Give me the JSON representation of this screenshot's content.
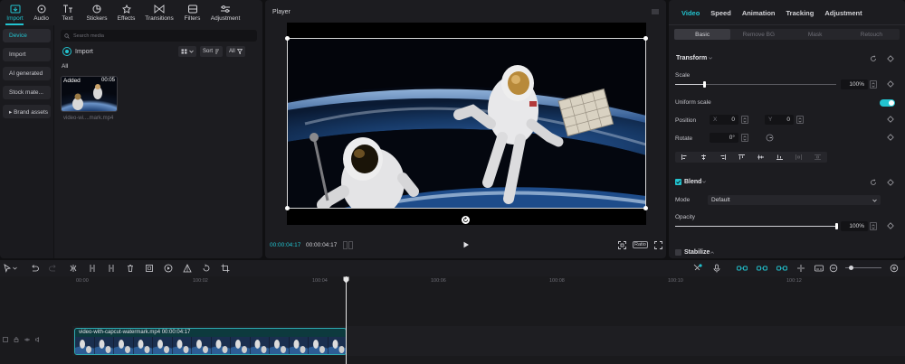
{
  "top_tools": [
    {
      "label": "Import",
      "icon": "import-icon"
    },
    {
      "label": "Audio",
      "icon": "audio-icon"
    },
    {
      "label": "Text",
      "icon": "text-icon"
    },
    {
      "label": "Stickers",
      "icon": "stickers-icon"
    },
    {
      "label": "Effects",
      "icon": "effects-icon"
    },
    {
      "label": "Transitions",
      "icon": "transitions-icon"
    },
    {
      "label": "Filters",
      "icon": "filters-icon"
    },
    {
      "label": "Adjustment",
      "icon": "adjustment-icon"
    }
  ],
  "left_nav": [
    {
      "label": "Device"
    },
    {
      "label": "Import"
    },
    {
      "label": "AI generated"
    },
    {
      "label": "Stock mate..."
    },
    {
      "label": "▸ Brand assets"
    }
  ],
  "media": {
    "search_placeholder": "Search media",
    "import_label": "Import",
    "sort_label": "Sort",
    "all_button": "All",
    "all_section": "All",
    "thumb": {
      "badge": "Added",
      "duration": "00:05",
      "filename": "video-wi....mark.mp4"
    }
  },
  "player": {
    "title": "Player",
    "current_time": "00:00:04:17",
    "total_time": "00:00:04:17",
    "ratio_label": "Ratio"
  },
  "right_panel": {
    "tabs": [
      "Video",
      "Speed",
      "Animation",
      "Tracking",
      "Adjustment"
    ],
    "subtabs": [
      "Basic",
      "Remove BG",
      "Mask",
      "Retouch"
    ],
    "transform_title": "Transform",
    "scale_label": "Scale",
    "scale_value": "100%",
    "scale_level": 0.18,
    "uniform_scale_label": "Uniform scale",
    "uniform_scale_on": true,
    "position_label": "Position",
    "position_x_key": "X",
    "position_x": "0",
    "position_y_key": "Y",
    "position_y": "0",
    "rotate_label": "Rotate",
    "rotate_value": "0°",
    "blend_title": "Blend",
    "mode_label": "Mode",
    "mode_value": "Default",
    "opacity_label": "Opacity",
    "opacity_value": "100%",
    "opacity_level": 1.0,
    "stabilize_title": "Stabilize"
  },
  "timeline": {
    "ruler": [
      "00:00",
      "100:02",
      "100:04",
      "100:06",
      "100:08",
      "100:10",
      "100:12"
    ],
    "clip_label": "video-with-capcut-watermark.mp4  00:00:04:17"
  },
  "colors": {
    "accent": "#22c3cf",
    "panel": "#1c1c20",
    "background": "#101012"
  }
}
